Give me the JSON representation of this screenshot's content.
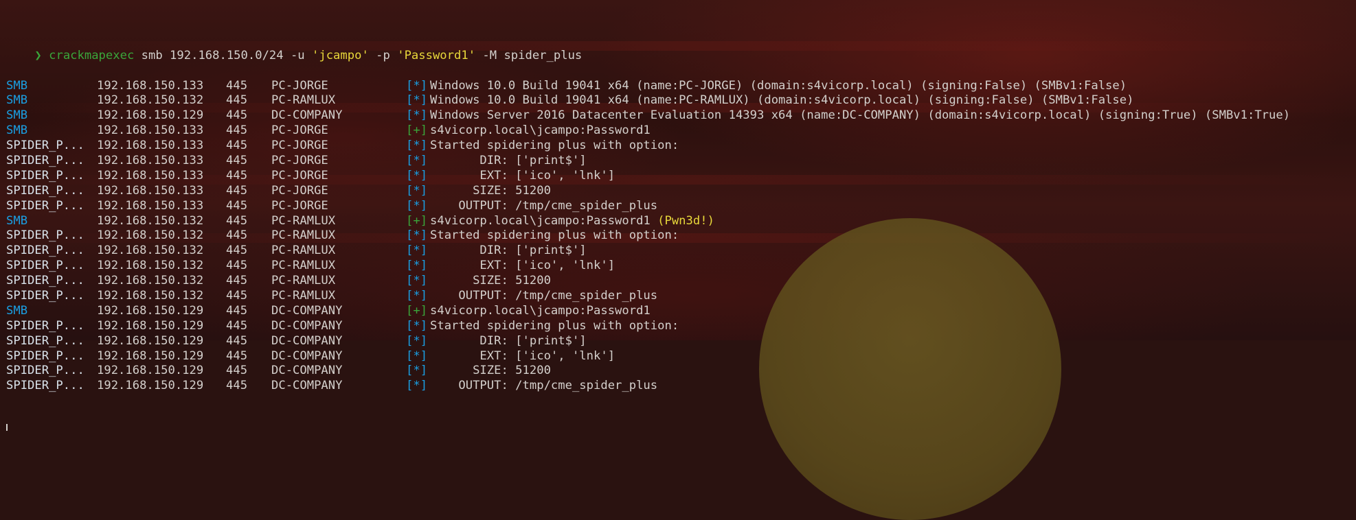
{
  "prompt": {
    "arrow": "❯",
    "command": "crackmapexec",
    "args_1": " smb 192.168.150.0/24 -u ",
    "user": "'jcampo'",
    "args_2": " -p ",
    "password": "'Password1'",
    "args_3": " -M spider_plus"
  },
  "rows": [
    {
      "module": "SMB",
      "ip": "192.168.150.133",
      "port": "445",
      "host": "PC-JORGE",
      "tag": "[*]",
      "msg": "Windows 10.0 Build 19041 x64 (name:PC-JORGE) (domain:s4vicorp.local) (signing:False) (SMBv1:False)",
      "pwned": ""
    },
    {
      "module": "SMB",
      "ip": "192.168.150.132",
      "port": "445",
      "host": "PC-RAMLUX",
      "tag": "[*]",
      "msg": "Windows 10.0 Build 19041 x64 (name:PC-RAMLUX) (domain:s4vicorp.local) (signing:False) (SMBv1:False)",
      "pwned": ""
    },
    {
      "module": "SMB",
      "ip": "192.168.150.129",
      "port": "445",
      "host": "DC-COMPANY",
      "tag": "[*]",
      "msg": "Windows Server 2016 Datacenter Evaluation 14393 x64 (name:DC-COMPANY) (domain:s4vicorp.local) (signing:True) (SMBv1:True)",
      "pwned": ""
    },
    {
      "module": "SMB",
      "ip": "192.168.150.133",
      "port": "445",
      "host": "PC-JORGE",
      "tag": "[+]",
      "msg": "s4vicorp.local\\jcampo:Password1",
      "pwned": ""
    },
    {
      "module": "SPIDER_P...",
      "ip": "192.168.150.133",
      "port": "445",
      "host": "PC-JORGE",
      "tag": "[*]",
      "msg": "Started spidering plus with option:",
      "pwned": ""
    },
    {
      "module": "SPIDER_P...",
      "ip": "192.168.150.133",
      "port": "445",
      "host": "PC-JORGE",
      "tag": "[*]",
      "msg": "       DIR: ['print$']",
      "pwned": ""
    },
    {
      "module": "SPIDER_P...",
      "ip": "192.168.150.133",
      "port": "445",
      "host": "PC-JORGE",
      "tag": "[*]",
      "msg": "       EXT: ['ico', 'lnk']",
      "pwned": ""
    },
    {
      "module": "SPIDER_P...",
      "ip": "192.168.150.133",
      "port": "445",
      "host": "PC-JORGE",
      "tag": "[*]",
      "msg": "      SIZE: 51200",
      "pwned": ""
    },
    {
      "module": "SPIDER_P...",
      "ip": "192.168.150.133",
      "port": "445",
      "host": "PC-JORGE",
      "tag": "[*]",
      "msg": "    OUTPUT: /tmp/cme_spider_plus",
      "pwned": ""
    },
    {
      "module": "SMB",
      "ip": "192.168.150.132",
      "port": "445",
      "host": "PC-RAMLUX",
      "tag": "[+]",
      "msg": "s4vicorp.local\\jcampo:Password1 ",
      "pwned": "(Pwn3d!)"
    },
    {
      "module": "SPIDER_P...",
      "ip": "192.168.150.132",
      "port": "445",
      "host": "PC-RAMLUX",
      "tag": "[*]",
      "msg": "Started spidering plus with option:",
      "pwned": ""
    },
    {
      "module": "SPIDER_P...",
      "ip": "192.168.150.132",
      "port": "445",
      "host": "PC-RAMLUX",
      "tag": "[*]",
      "msg": "       DIR: ['print$']",
      "pwned": ""
    },
    {
      "module": "SPIDER_P...",
      "ip": "192.168.150.132",
      "port": "445",
      "host": "PC-RAMLUX",
      "tag": "[*]",
      "msg": "       EXT: ['ico', 'lnk']",
      "pwned": ""
    },
    {
      "module": "SPIDER_P...",
      "ip": "192.168.150.132",
      "port": "445",
      "host": "PC-RAMLUX",
      "tag": "[*]",
      "msg": "      SIZE: 51200",
      "pwned": ""
    },
    {
      "module": "SPIDER_P...",
      "ip": "192.168.150.132",
      "port": "445",
      "host": "PC-RAMLUX",
      "tag": "[*]",
      "msg": "    OUTPUT: /tmp/cme_spider_plus",
      "pwned": ""
    },
    {
      "module": "SMB",
      "ip": "192.168.150.129",
      "port": "445",
      "host": "DC-COMPANY",
      "tag": "[+]",
      "msg": "s4vicorp.local\\jcampo:Password1",
      "pwned": ""
    },
    {
      "module": "SPIDER_P...",
      "ip": "192.168.150.129",
      "port": "445",
      "host": "DC-COMPANY",
      "tag": "[*]",
      "msg": "Started spidering plus with option:",
      "pwned": ""
    },
    {
      "module": "SPIDER_P...",
      "ip": "192.168.150.129",
      "port": "445",
      "host": "DC-COMPANY",
      "tag": "[*]",
      "msg": "       DIR: ['print$']",
      "pwned": ""
    },
    {
      "module": "SPIDER_P...",
      "ip": "192.168.150.129",
      "port": "445",
      "host": "DC-COMPANY",
      "tag": "[*]",
      "msg": "       EXT: ['ico', 'lnk']",
      "pwned": ""
    },
    {
      "module": "SPIDER_P...",
      "ip": "192.168.150.129",
      "port": "445",
      "host": "DC-COMPANY",
      "tag": "[*]",
      "msg": "      SIZE: 51200",
      "pwned": ""
    },
    {
      "module": "SPIDER_P...",
      "ip": "192.168.150.129",
      "port": "445",
      "host": "DC-COMPANY",
      "tag": "[*]",
      "msg": "    OUTPUT: /tmp/cme_spider_plus",
      "pwned": ""
    }
  ],
  "colors": {
    "module_smb": "#1a9fe3",
    "module_spider": "#d8e2ea",
    "tag_info": "#1a9fe3",
    "tag_success": "#3aa63a",
    "pwned_highlight": "#e8d83a",
    "prompt_command": "#3aa63a",
    "prompt_string": "#e8d83a",
    "text": "#d4d0cc"
  }
}
